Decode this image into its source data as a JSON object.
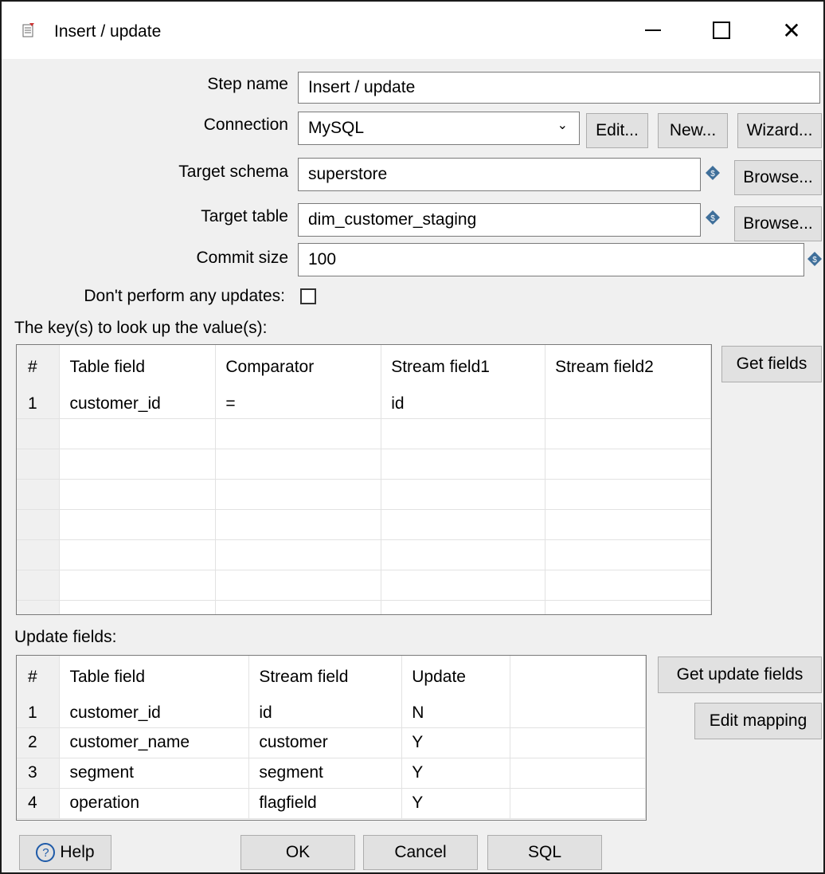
{
  "window": {
    "title": "Insert / update",
    "icon": "table-insert-icon"
  },
  "form": {
    "step_name_label": "Step name",
    "step_name_value": "Insert / update",
    "connection_label": "Connection",
    "connection_value": "MySQL",
    "edit_label": "Edit...",
    "new_label": "New...",
    "wizard_label": "Wizard...",
    "target_schema_label": "Target schema",
    "target_schema_value": "superstore",
    "browse_label": "Browse...",
    "target_table_label": "Target table",
    "target_table_value": "dim_customer_staging",
    "commit_size_label": "Commit size",
    "commit_size_value": "100",
    "no_updates_label": "Don't perform any updates:"
  },
  "keys": {
    "section_label": "The key(s) to look up the value(s):",
    "get_fields_label": "Get fields",
    "headers": [
      "#",
      "Table field",
      "Comparator",
      "Stream field1",
      "Stream field2"
    ],
    "rows": [
      [
        "1",
        "customer_id",
        "=",
        "id",
        ""
      ]
    ]
  },
  "update": {
    "section_label": "Update fields:",
    "get_update_fields_label": "Get update fields",
    "edit_mapping_label": "Edit mapping",
    "headers": [
      "#",
      "Table field",
      "Stream field",
      "Update"
    ],
    "rows": [
      [
        "1",
        "customer_id",
        "id",
        "N"
      ],
      [
        "2",
        "customer_name",
        "customer",
        "Y"
      ],
      [
        "3",
        "segment",
        "segment",
        "Y"
      ],
      [
        "4",
        "operation",
        "flagfield",
        "Y"
      ]
    ]
  },
  "footer": {
    "help_label": "Help",
    "ok_label": "OK",
    "cancel_label": "Cancel",
    "sql_label": "SQL"
  }
}
